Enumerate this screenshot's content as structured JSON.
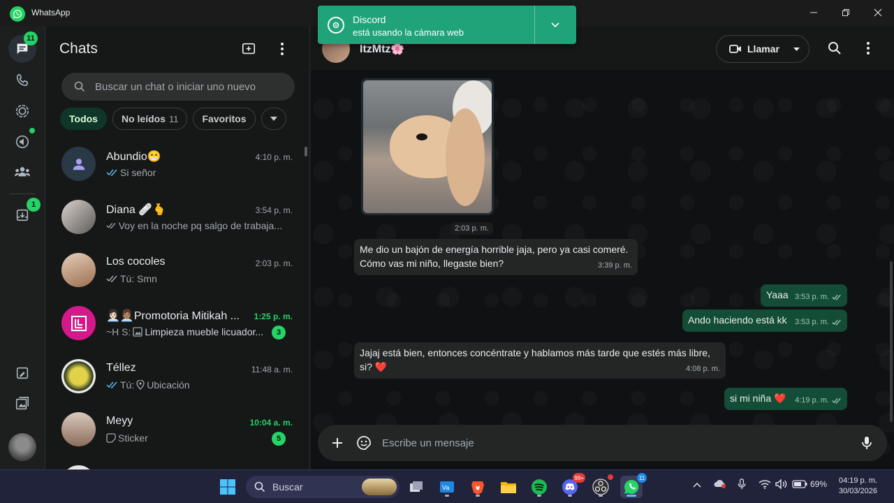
{
  "titlebar": {
    "app_name": "WhatsApp"
  },
  "rail": {
    "chats_badge": "11",
    "archive_badge": "1"
  },
  "chatlist": {
    "title": "Chats",
    "search_placeholder": "Buscar un chat o iniciar uno nuevo",
    "filters": {
      "all": "Todos",
      "unread": "No leídos",
      "unread_count": "11",
      "favorites": "Favoritos"
    },
    "chats": [
      {
        "name": "Abundio😁",
        "time": "4:10 p. m.",
        "preview": "Si señor",
        "read": true,
        "unread": ""
      },
      {
        "name": "Diana 🩹🫰",
        "time": "3:54 p. m.",
        "preview": "Voy en la noche pq salgo de trabaja...",
        "read": false,
        "unread": ""
      },
      {
        "name": "Los cocoles",
        "time": "2:03 p. m.",
        "preview": "Tú: Smn",
        "read": false,
        "unread": ""
      },
      {
        "name": "👩🏻‍💼👩🏽‍💼Promotoria Mitikah ...",
        "time": "1:25 p. m.",
        "preview": "~H S: ",
        "preview_media": "Limpieza mueble licuador...",
        "unread": "3"
      },
      {
        "name": "Téllez",
        "time": "11:48 a. m.",
        "preview": "Tú: ",
        "preview_media": "Ubicación",
        "read": true,
        "unread": ""
      },
      {
        "name": "Meyy",
        "time": "10:04 a. m.",
        "preview": "Sticker",
        "unread": "5"
      }
    ]
  },
  "conversation": {
    "contact_name": "ItzMtz🌸",
    "call_label": "Llamar",
    "composer_placeholder": "Escribe un mensaje",
    "photo_time": "2:03 p. m.",
    "messages": [
      {
        "dir": "in",
        "text_line1": "Me dio un bajón de energía horrible jaja, pero ya casi comeré.",
        "text_line2": "Cómo vas mi niño, llegaste bien?",
        "time": "3:39 p. m."
      },
      {
        "dir": "out",
        "text": "Yaaa",
        "time": "3:53 p. m."
      },
      {
        "dir": "out",
        "text": "Ando haciendo está kk",
        "time": "3:53 p. m."
      },
      {
        "dir": "in",
        "text_line1": "Jajaj está bien, entonces concéntrate y hablamos más tarde que estés más libre,",
        "text_line2": "si? ❤️",
        "time": "4:08 p. m."
      },
      {
        "dir": "out",
        "text": "si mi niña ❤️",
        "time": "4:19 p. m."
      }
    ]
  },
  "toast": {
    "title": "Discord",
    "subtitle": "está usando la cámara web"
  },
  "taskbar": {
    "search_label": "Buscar",
    "battery": "69%",
    "time": "04:19 p. m.",
    "date": "30/03/2026",
    "whatsapp_badge": "11",
    "discord_badge": "99+"
  },
  "colors": {
    "accent": "#25d366",
    "outgoing": "#144d37",
    "incoming": "#242626",
    "toast": "#21a37a"
  }
}
